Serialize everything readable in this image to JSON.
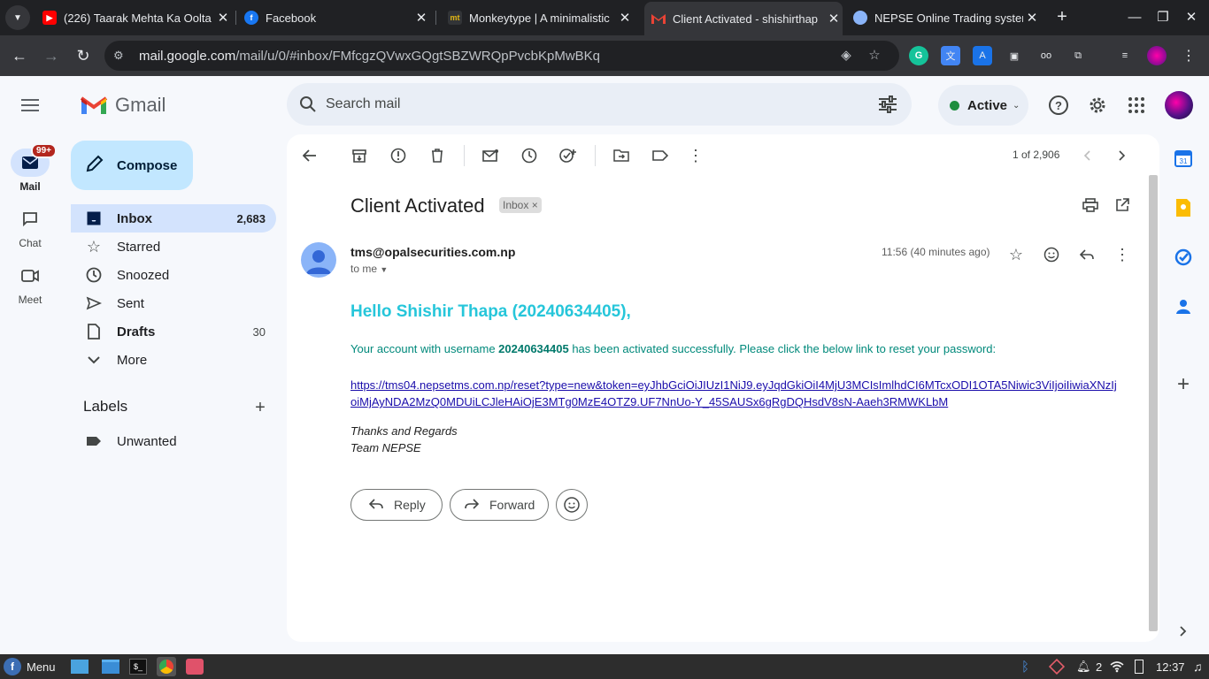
{
  "browser": {
    "tabs": [
      {
        "title": "(226) Taarak Mehta Ka Oolta",
        "icon": "youtube-icon",
        "color": "#ff0000"
      },
      {
        "title": "Facebook",
        "icon": "facebook-icon",
        "color": "#1877f2"
      },
      {
        "title": "Monkeytype | A minimalistic",
        "icon": "monkeytype-icon",
        "color": "#e2b714"
      },
      {
        "title": "Client Activated - shishirthap",
        "icon": "gmail-icon",
        "color": "#ea4335"
      },
      {
        "title": "NEPSE Online Trading system",
        "icon": "globe-icon",
        "color": "#8ab4f8"
      }
    ],
    "url_host": "mail.google.com",
    "url_path": "/mail/u/0/#inbox/FMfcgzQVwxGQgtSBZWRQpPvcbKpMwBKq"
  },
  "gmail": {
    "app_name": "Gmail",
    "search_placeholder": "Search mail",
    "status": "Active",
    "rail": {
      "mail": "Mail",
      "chat": "Chat",
      "meet": "Meet",
      "badge": "99+"
    },
    "compose": "Compose",
    "folders": [
      {
        "label": "Inbox",
        "count": "2,683"
      },
      {
        "label": "Starred",
        "count": ""
      },
      {
        "label": "Snoozed",
        "count": ""
      },
      {
        "label": "Sent",
        "count": ""
      },
      {
        "label": "Drafts",
        "count": "30"
      },
      {
        "label": "More",
        "count": ""
      }
    ],
    "labels_heading": "Labels",
    "labels": [
      "Unwanted"
    ]
  },
  "email": {
    "pager": "1 of 2,906",
    "subject": "Client Activated",
    "chip": "Inbox",
    "chip_close": "×",
    "sender": "tms@opalsecurities.com.np",
    "to": "to me",
    "time": "11:56 (40 minutes ago)",
    "greeting": "Hello Shishir Thapa (20240634405),",
    "body_pre": "Your account with username ",
    "body_user": "20240634405",
    "body_post": " has been activated successfully. Please click the below link to reset your password:",
    "link": "https://tms04.nepsetms.com.np/reset?type=new&token=eyJhbGciOiJIUzI1NiJ9.eyJqdGkiOiI4MjU3MCIsImlhdCI6MTcxODI1OTA5Niwic3ViIjoiIiwiaXNzIjoiMjAyNDA2MzQ0MDUiLCJleHAiOjE3MTg0MzE4OTZ9.UF7NnUo-Y_45SAUSx6gRgDQHsdV8sN-Aaeh3RMWKLbM",
    "sig1": "Thanks and Regards",
    "sig2": "Team NEPSE",
    "reply": "Reply",
    "forward": "Forward"
  },
  "taskbar": {
    "menu": "Menu",
    "count": "2",
    "clock": "12:37"
  }
}
